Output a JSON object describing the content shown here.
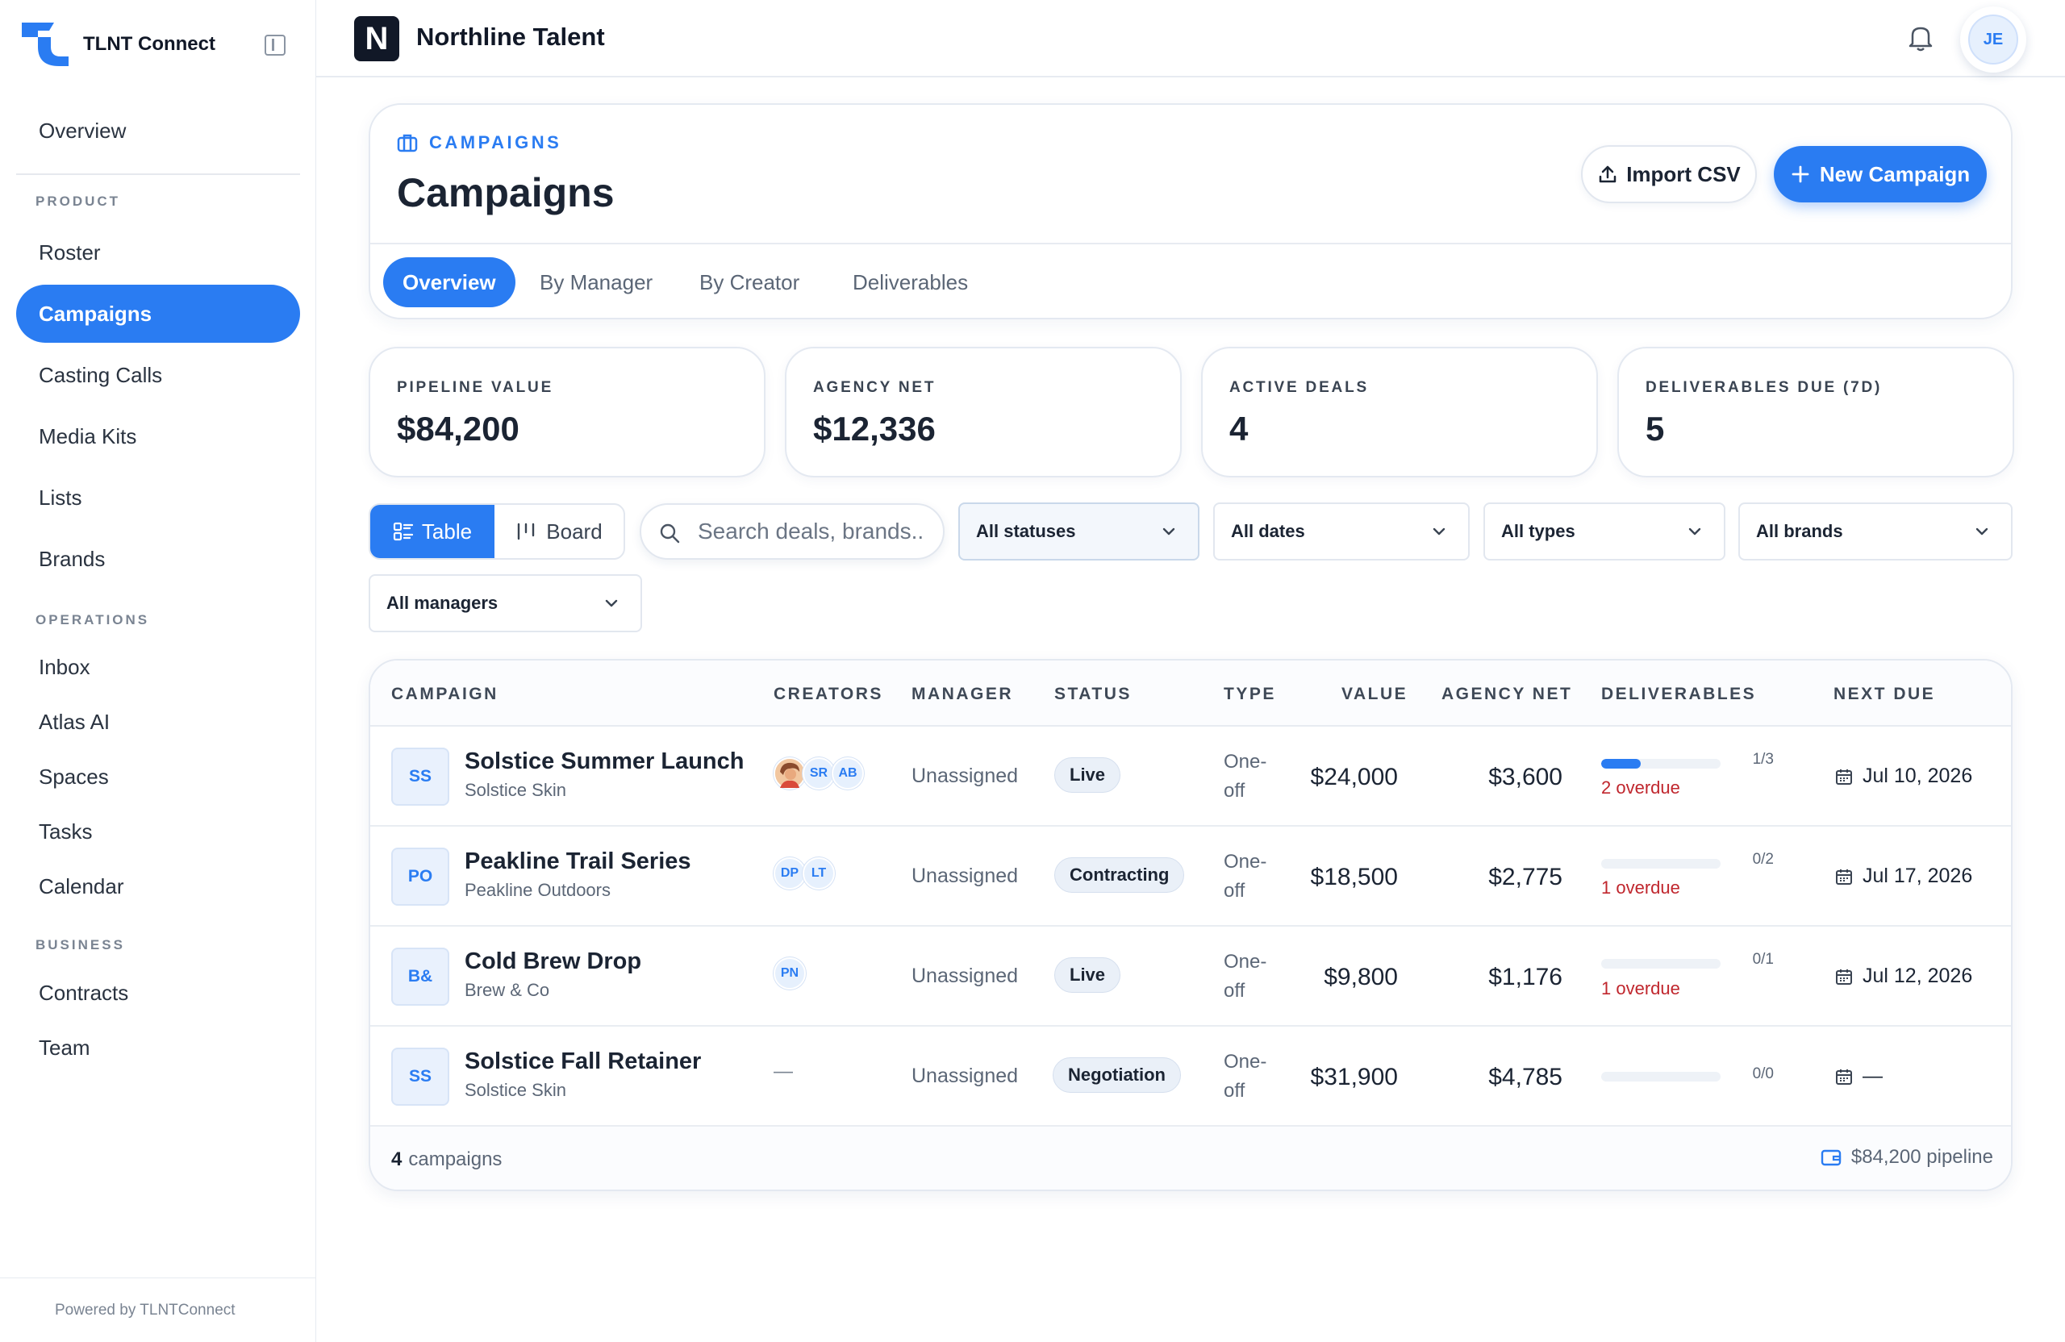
{
  "sidebar": {
    "brand": "TLNT Connect",
    "overview": "Overview",
    "sections": {
      "product": "PRODUCT",
      "operations": "OPERATIONS",
      "business": "BUSINESS"
    },
    "items": {
      "roster": "Roster",
      "campaigns": "Campaigns",
      "casting_calls": "Casting Calls",
      "media_kits": "Media Kits",
      "lists": "Lists",
      "brands": "Brands",
      "inbox": "Inbox",
      "atlas_ai": "Atlas AI",
      "spaces": "Spaces",
      "tasks": "Tasks",
      "calendar": "Calendar",
      "contracts": "Contracts",
      "team": "Team"
    },
    "footer": "Powered by TLNTConnect"
  },
  "topbar": {
    "org_initial": "N",
    "org_name": "Northline Talent",
    "user_initials": "JE"
  },
  "header": {
    "eyebrow": "CAMPAIGNS",
    "title": "Campaigns",
    "import_label": "Import CSV",
    "new_label": "New Campaign",
    "tabs": [
      "Overview",
      "By Manager",
      "By Creator",
      "Deliverables"
    ]
  },
  "stats": [
    {
      "label": "PIPELINE VALUE",
      "value": "$84,200"
    },
    {
      "label": "AGENCY NET",
      "value": "$12,336"
    },
    {
      "label": "ACTIVE DEALS",
      "value": "4"
    },
    {
      "label": "DELIVERABLES DUE (7D)",
      "value": "5"
    }
  ],
  "toolbar": {
    "table_label": "Table",
    "board_label": "Board",
    "search_placeholder": "Search deals, brands..",
    "filters": {
      "status": "All statuses",
      "dates": "All dates",
      "types": "All types",
      "brands": "All brands",
      "managers": "All managers"
    }
  },
  "table": {
    "columns": [
      "CAMPAIGN",
      "CREATORS",
      "MANAGER",
      "STATUS",
      "TYPE",
      "VALUE",
      "AGENCY NET",
      "DELIVERABLES",
      "NEXT DUE"
    ],
    "rows": [
      {
        "initials": "SS",
        "name": "Solstice Summer Launch",
        "brand": "Solstice Skin",
        "creators": [
          "SR",
          "AB"
        ],
        "manager": "Unassigned",
        "status": "Live",
        "type1": "One-",
        "type2": "off",
        "value": "$24,000",
        "net": "$3,600",
        "progress": 0.333,
        "count": "1/3",
        "overdue": "2 overdue",
        "next_due": "Jul 10, 2026"
      },
      {
        "initials": "PO",
        "name": "Peakline Trail Series",
        "brand": "Peakline Outdoors",
        "creators": [
          "DP",
          "LT"
        ],
        "manager": "Unassigned",
        "status": "Contracting",
        "type1": "One-",
        "type2": "off",
        "value": "$18,500",
        "net": "$2,775",
        "progress": 0,
        "count": "0/2",
        "overdue": "1 overdue",
        "next_due": "Jul 17, 2026"
      },
      {
        "initials": "B&",
        "name": "Cold Brew Drop",
        "brand": "Brew & Co",
        "creators": [
          "PN"
        ],
        "manager": "Unassigned",
        "status": "Live",
        "type1": "One-",
        "type2": "off",
        "value": "$9,800",
        "net": "$1,176",
        "progress": 0,
        "count": "0/1",
        "overdue": "1 overdue",
        "next_due": "Jul 12, 2026"
      },
      {
        "initials": "SS",
        "name": "Solstice Fall Retainer",
        "brand": "Solstice Skin",
        "creators_empty": "—",
        "manager": "Unassigned",
        "status": "Negotiation",
        "type1": "One-",
        "type2": "off",
        "value": "$31,900",
        "net": "$4,785",
        "progress": 0,
        "count": "0/0",
        "next_due": "—"
      }
    ],
    "footer": {
      "count": "4",
      "count_label": "campaigns",
      "pipeline": "$84,200 pipeline"
    }
  },
  "colors": {
    "accent": "#2a7cf2",
    "overdue": "#c0262d"
  }
}
